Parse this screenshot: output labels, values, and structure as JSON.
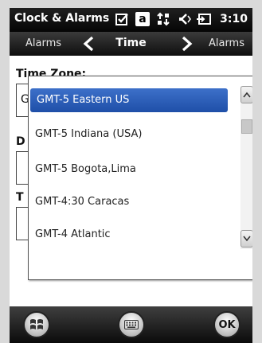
{
  "statusbar": {
    "app_title": "Clock & Alarms",
    "time": "3:10",
    "icons": [
      "checkbox-icon",
      "keyboard-letter-a-icon",
      "network-connection-icon",
      "speaker-mute-icon",
      "battery-charging-icon"
    ],
    "keyboard_letter": "a"
  },
  "navbar": {
    "left_label": "Alarms",
    "title": "Time",
    "right_label": "Alarms",
    "icons": [
      "chevron-left-icon",
      "chevron-right-icon"
    ]
  },
  "content": {
    "timezone_label": "Time Zone:",
    "field_letters": [
      "G",
      "D",
      "T"
    ]
  },
  "dropdown": {
    "options": [
      "GMT-5 Eastern US",
      "GMT-5 Indiana (USA)",
      "GMT-5 Bogota,Lima",
      "GMT-4:30 Caracas",
      "GMT-4 Atlantic"
    ],
    "selected": "GMT-5 Eastern US",
    "icons": [
      "scroll-up-icon",
      "scroll-thumb",
      "scroll-down-icon"
    ]
  },
  "toolbar": {
    "ok_label": "OK",
    "icons": [
      "windows-start-icon",
      "keyboard-icon",
      "ok-button"
    ]
  },
  "colors": {
    "selection": "#2c5fbe",
    "bar_dark": "#0e0e0e"
  }
}
